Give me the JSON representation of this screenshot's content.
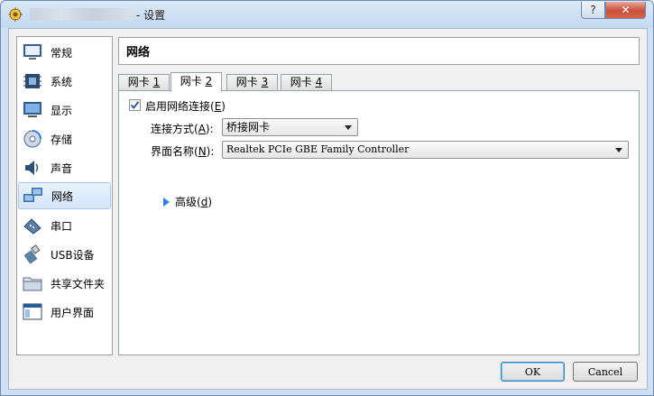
{
  "window": {
    "title_suffix": "- 设置",
    "help_label": "?",
    "close_label": "✕"
  },
  "sidebar": {
    "items": [
      {
        "label": "常规",
        "icon": "monitor-general-icon"
      },
      {
        "label": "系统",
        "icon": "chip-system-icon"
      },
      {
        "label": "显示",
        "icon": "display-icon"
      },
      {
        "label": "存储",
        "icon": "storage-disc-icon"
      },
      {
        "label": "声音",
        "icon": "speaker-icon"
      },
      {
        "label": "网络",
        "icon": "network-icon",
        "selected": true
      },
      {
        "label": "串口",
        "icon": "serial-port-icon"
      },
      {
        "label": "USB设备",
        "icon": "usb-icon"
      },
      {
        "label": "共享文件夹",
        "icon": "folder-icon"
      },
      {
        "label": "用户界面",
        "icon": "user-interface-icon"
      }
    ]
  },
  "header": {
    "title": "网络"
  },
  "tabs": [
    {
      "label": "网卡 ",
      "key": "1"
    },
    {
      "label": "网卡 ",
      "key": "2",
      "active": true
    },
    {
      "label": "网卡 ",
      "key": "3"
    },
    {
      "label": "网卡 ",
      "key": "4"
    }
  ],
  "adapter": {
    "enable_label": "启用网络连接(",
    "enable_key": "E",
    "enable_suffix": ")",
    "enabled": true,
    "attached_label": "连接方式(",
    "attached_key": "A",
    "attached_suffix": "):",
    "attached_value": "桥接网卡",
    "name_label": "界面名称(",
    "name_key": "N",
    "name_suffix": "):",
    "name_value": "Realtek PCIe GBE Family Controller",
    "advanced_label": "高级(",
    "advanced_key": "d",
    "advanced_suffix": ")"
  },
  "buttons": {
    "ok": "OK",
    "cancel": "Cancel"
  },
  "colors": {
    "accent": "#2f7fd6",
    "close": "#c74f3b",
    "selection": "#d3e5fa"
  }
}
